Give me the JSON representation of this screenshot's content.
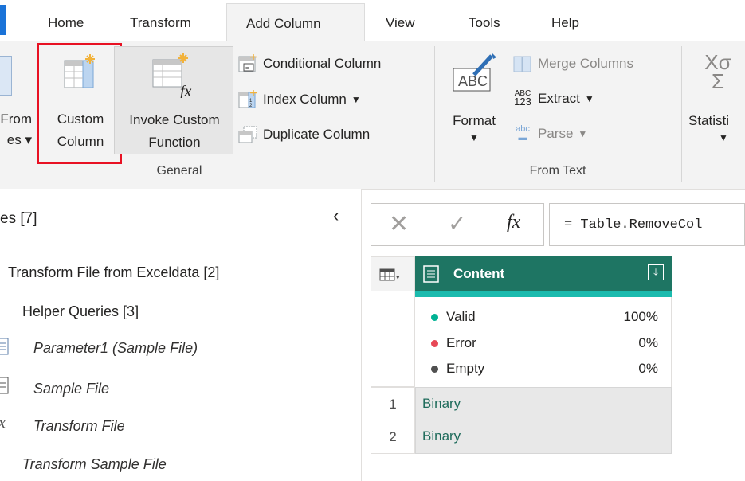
{
  "tabs": [
    "Home",
    "Transform",
    "Add Column",
    "View",
    "Tools",
    "Help"
  ],
  "ribbon": {
    "from_partial": [
      "From",
      "es"
    ],
    "custom_column": [
      "Custom",
      "Column"
    ],
    "invoke_custom_function": [
      "Invoke Custom",
      "Function"
    ],
    "conditional_column": "Conditional Column",
    "index_column": "Index Column",
    "duplicate_column": "Duplicate Column",
    "general_label": "General",
    "format": "Format",
    "merge_columns": "Merge Columns",
    "extract": "Extract",
    "parse": "Parse",
    "from_text_label": "From Text",
    "statistics_partial": "Statisti",
    "extract_icon_text": [
      "ABC",
      "123"
    ],
    "parse_icon_text": "abc",
    "format_icon_text": "ABC",
    "sigma": "Σ",
    "xsigma": "Xσ"
  },
  "queries": {
    "header": "es [7]",
    "items": [
      {
        "label": "Transform File from Exceldata [2]"
      },
      {
        "label": "Helper Queries [3]"
      },
      {
        "label": "Parameter1 (Sample File)"
      },
      {
        "label": "Sample File"
      },
      {
        "label": "Transform File"
      },
      {
        "label": "Transform Sample File"
      }
    ]
  },
  "formula": {
    "fx": "fx",
    "text": "= Table.RemoveCol"
  },
  "grid": {
    "column": "Content",
    "quality": [
      {
        "label": "Valid",
        "value": "100%",
        "color": "#00b294"
      },
      {
        "label": "Error",
        "value": "0%",
        "color": "#e74856"
      },
      {
        "label": "Empty",
        "value": "0%",
        "color": "#505050"
      }
    ],
    "rows": [
      {
        "n": "1",
        "v": "Binary"
      },
      {
        "n": "2",
        "v": "Binary"
      }
    ]
  },
  "colors": {
    "header_green": "#1e7563",
    "quality_bar": "#1bbbae",
    "highlight_red": "#e81123",
    "accent_blue": "#1a73d8",
    "binary_text": "#1e6b5b"
  }
}
